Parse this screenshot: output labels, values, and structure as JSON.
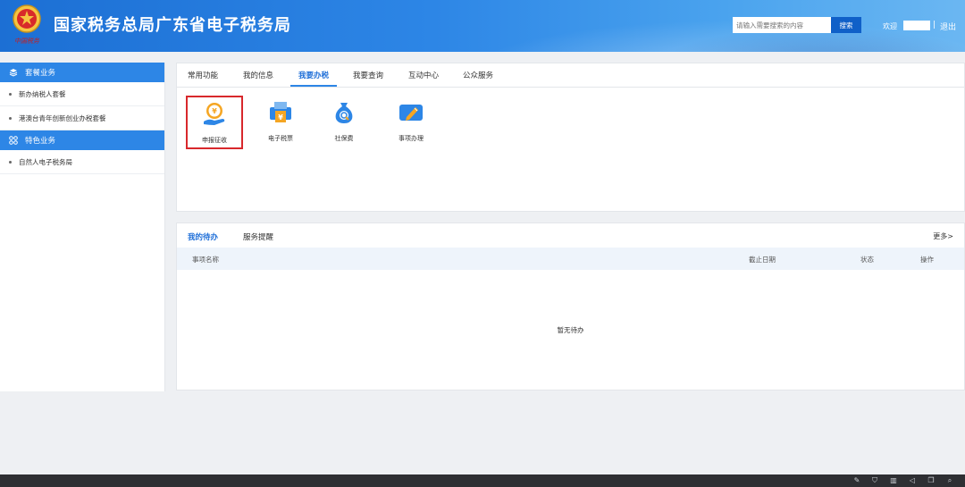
{
  "header": {
    "title": "国家税务总局广东省电子税务局",
    "search_placeholder": "请输入需要搜索的内容",
    "search_button": "搜索",
    "welcome": "欢迎",
    "separator": "|",
    "logout": "退出",
    "logo_text": "中国税务"
  },
  "sidebar": {
    "groups": [
      {
        "label": "套餐业务",
        "items": [
          "新办纳税人套餐",
          "港澳台青年创新创业办税套餐"
        ]
      },
      {
        "label": "特色业务",
        "items": [
          "自然人电子税务局"
        ]
      }
    ]
  },
  "main_tabs": [
    "常用功能",
    "我的信息",
    "我要办税",
    "我要查询",
    "互动中心",
    "公众服务"
  ],
  "active_tab": "我要办税",
  "apps": [
    {
      "label": "申报征收",
      "icon": "tax-declare-icon",
      "selected": true
    },
    {
      "label": "电子税票",
      "icon": "e-ticket-icon",
      "selected": false
    },
    {
      "label": "社保费",
      "icon": "social-security-icon",
      "selected": false
    },
    {
      "label": "事项办理",
      "icon": "matter-handle-icon",
      "selected": false
    }
  ],
  "todo": {
    "tabs": [
      "我的待办",
      "服务提醒"
    ],
    "more": "更多>",
    "columns": [
      "事项名称",
      "截止日期",
      "状态",
      "操作"
    ],
    "empty_text": "暂无待办"
  },
  "colors": {
    "brand_blue": "#2d86e6",
    "active_tab": "#1f6fd8",
    "selected_border": "#d8282c"
  }
}
